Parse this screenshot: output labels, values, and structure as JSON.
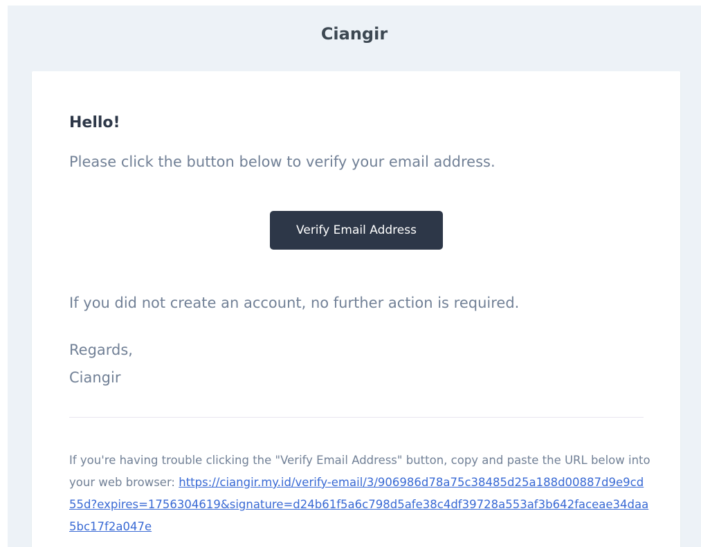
{
  "header": {
    "brand": "Ciangir"
  },
  "email": {
    "greeting": "Hello!",
    "intro": "Please click the button below to verify your email address.",
    "button_label": "Verify Email Address",
    "no_action": "If you did not create an account, no further action is required.",
    "regards_line": "Regards,",
    "signature": "Ciangir",
    "subcopy_text": "If you're having trouble clicking the \"Verify Email Address\" button, copy and paste the URL below into your web browser: ",
    "verify_url": "https://ciangir.my.id/verify-email/3/906986d78a75c38485d25a188d00887d9e9cd55d?expires=1756304619&signature=d24b61f5a6c798d5afe38c4df39728a553af3b642faceae34daa5bc17f2a047e"
  },
  "colors": {
    "background": "#edf2f7",
    "card": "#ffffff",
    "button": "#2d3748",
    "text_muted": "#718096",
    "heading": "#2d3748",
    "link": "#3869d4"
  }
}
